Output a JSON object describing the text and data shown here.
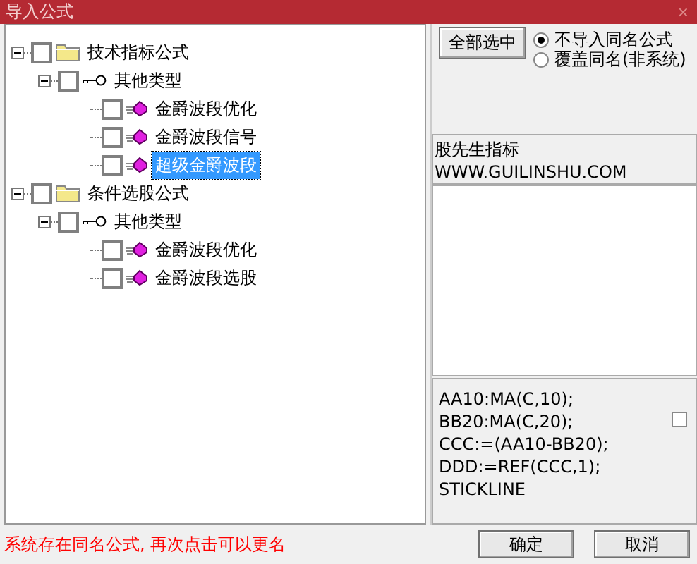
{
  "window": {
    "title": "导入公式",
    "close": "×"
  },
  "tree": [
    {
      "label": "技术指标公式",
      "kind": "folder",
      "expanded": true,
      "checked": false,
      "selected": false,
      "children": [
        {
          "label": "其他类型",
          "kind": "type",
          "expanded": true,
          "checked": false,
          "selected": false,
          "children": [
            {
              "label": "金爵波段优化",
              "kind": "formula",
              "checked": false,
              "selected": false
            },
            {
              "label": "金爵波段信号",
              "kind": "formula",
              "checked": false,
              "selected": false
            },
            {
              "label": "超级金爵波段",
              "kind": "formula",
              "checked": false,
              "selected": true
            }
          ]
        }
      ]
    },
    {
      "label": "条件选股公式",
      "kind": "folder",
      "expanded": true,
      "checked": false,
      "selected": false,
      "children": [
        {
          "label": "其他类型",
          "kind": "type",
          "expanded": true,
          "checked": false,
          "selected": false,
          "children": [
            {
              "label": "金爵波段优化",
              "kind": "formula",
              "checked": false,
              "selected": false
            },
            {
              "label": "金爵波段选股",
              "kind": "formula",
              "checked": false,
              "selected": false
            }
          ]
        }
      ]
    }
  ],
  "select_all_button": "全部选中",
  "options": [
    {
      "label": "不导入同名公式",
      "selected": true
    },
    {
      "label": "覆盖同名(非系统)",
      "selected": false
    }
  ],
  "description": [
    "股先生指标",
    "WWW.GUILINSHU.COM"
  ],
  "code": {
    "lines": [
      "AA10:MA(C,10);",
      "BB20:MA(C,20);",
      "CCC:=(AA10-BB20);",
      "DDD:=REF(CCC,1);",
      "STICKLINE"
    ],
    "checked": false
  },
  "status": "系统存在同名公式, 再次点击可以更名",
  "buttons": [
    "确定",
    "取消"
  ]
}
